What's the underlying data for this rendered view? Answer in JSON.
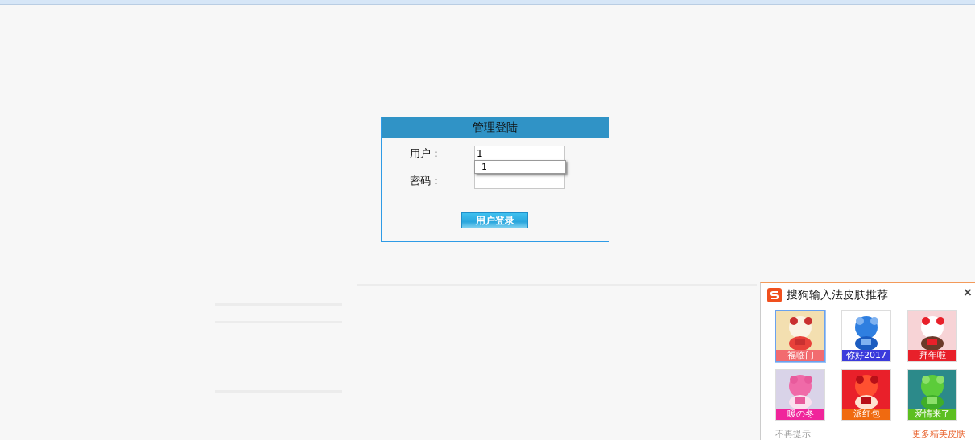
{
  "login": {
    "title": "管理登陆",
    "fields": [
      {
        "label": "用户：",
        "value": "1"
      },
      {
        "label": "密码："
      }
    ],
    "suggestions": [
      "1"
    ],
    "button": "用户登录"
  },
  "skin_popup": {
    "title": "搜狗输入法皮肤推荐",
    "close": "×",
    "skins": [
      {
        "name": "福临门",
        "color": "#f26b6f",
        "selected": true
      },
      {
        "name": "你好2017",
        "color": "#3b3bdc",
        "selected": false
      },
      {
        "name": "拜年啦",
        "color": "#e8202a",
        "selected": false
      },
      {
        "name": "暖の冬",
        "color": "#f0259b",
        "selected": false
      },
      {
        "name": "派红包",
        "color": "#f06a10",
        "selected": false
      },
      {
        "name": "爱情来了",
        "color": "#5cbf20",
        "selected": false
      }
    ],
    "footer_left": "不再提示",
    "footer_right": "更多精美皮肤"
  }
}
